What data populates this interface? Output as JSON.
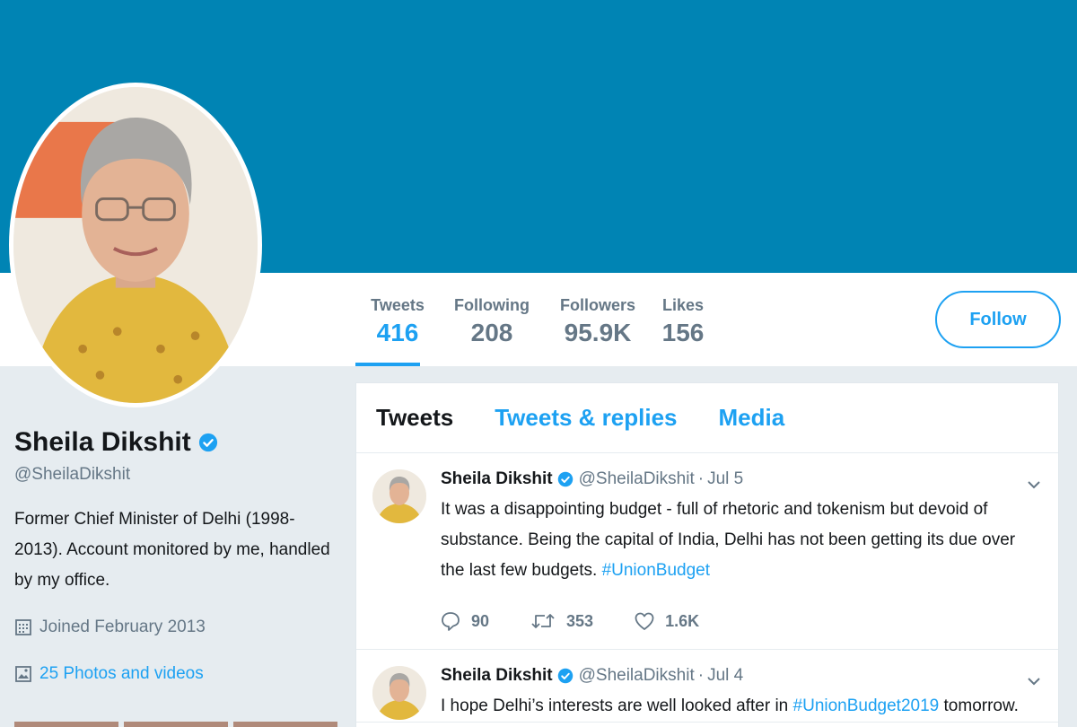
{
  "profile": {
    "name": "Sheila Dikshit",
    "handle": "@SheilaDikshit",
    "bio": "Former Chief Minister of Delhi (1998-2013). Account monitored by me, handled by my office.",
    "joined": "Joined February 2013",
    "photos_link": "25 Photos and videos"
  },
  "stats": [
    {
      "label": "Tweets",
      "value": "416"
    },
    {
      "label": "Following",
      "value": "208"
    },
    {
      "label": "Followers",
      "value": "95.9K"
    },
    {
      "label": "Likes",
      "value": "156"
    }
  ],
  "follow_label": "Follow",
  "tabs": [
    "Tweets",
    "Tweets & replies",
    "Media"
  ],
  "tweets": [
    {
      "name": "Sheila Dikshit",
      "handle": "@SheilaDikshit",
      "dot": "·",
      "date": "Jul 5",
      "text": "It was a disappointing budget - full of rhetoric and tokenism but devoid of substance. Being the capital of India, Delhi has not been getting its due over the last few budgets.",
      "hashtag": "#UnionBudget",
      "replies": "90",
      "retweets": "353",
      "likes": "1.6K"
    },
    {
      "name": "Sheila Dikshit",
      "handle": "@SheilaDikshit",
      "dot": "·",
      "date": "Jul 4",
      "text_before": "I hope Delhi’s interests are well looked after in",
      "hashtag": "#UnionBudget2019",
      "text_after": "tomorrow."
    }
  ],
  "colors": {
    "banner": "#0084b4",
    "accent": "#1da1f2",
    "background": "#e6ecf0",
    "muted": "#657786"
  },
  "icons": [
    "verified-badge-icon",
    "calendar-icon",
    "photo-icon",
    "chevron-down-icon",
    "reply-icon",
    "retweet-icon",
    "like-icon"
  ]
}
